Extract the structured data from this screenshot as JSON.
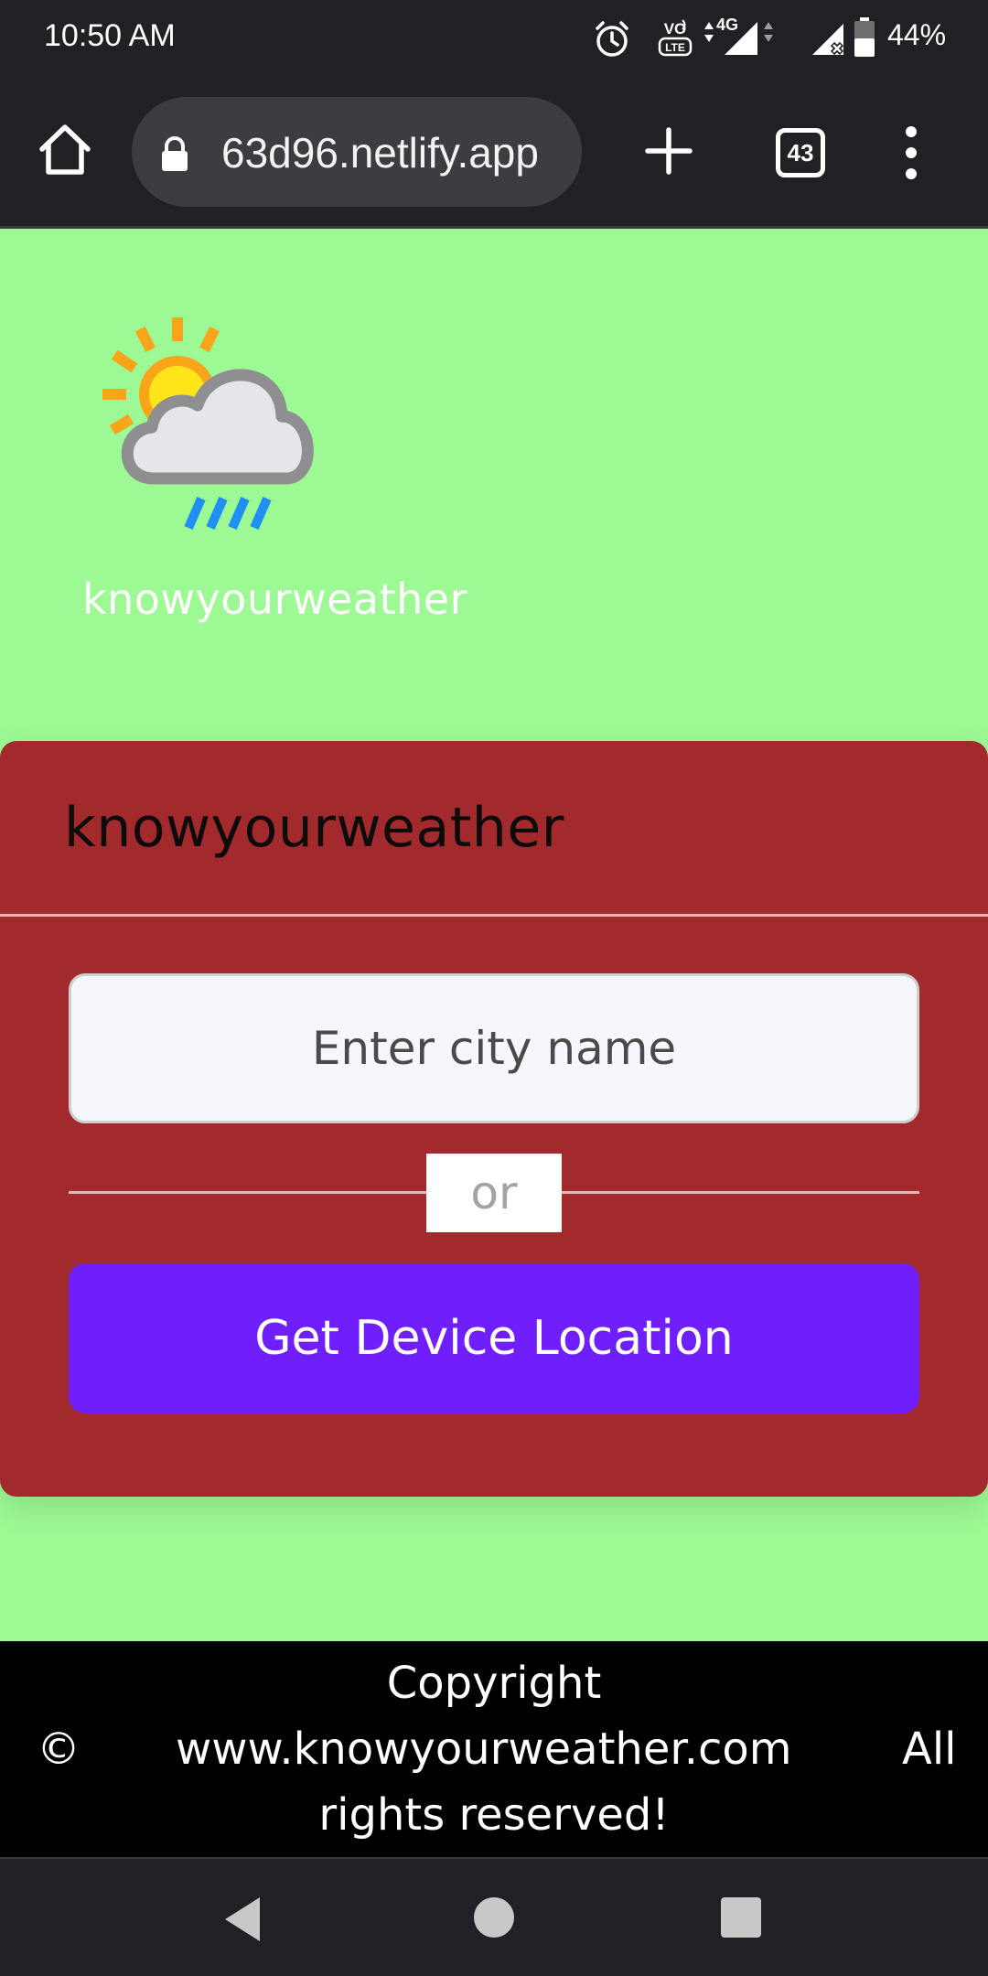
{
  "status_bar": {
    "time": "10:50 AM",
    "network": "4G",
    "volte": "VO LTE",
    "battery_percent": "44%",
    "icons": [
      "alarm-icon",
      "volte-icon",
      "signal-4g-icon",
      "signal-no-sim-icon",
      "battery-icon"
    ]
  },
  "browser": {
    "url": "63d96.netlify.app",
    "tab_count": "43",
    "icons": [
      "home-icon",
      "lock-icon",
      "plus-icon",
      "tabs-icon",
      "more-vert-icon"
    ]
  },
  "logo": {
    "text": "knowyourweather",
    "icon": "sun-cloud-rain-icon"
  },
  "card": {
    "title": "knowyourweather",
    "city_input_placeholder": "Enter city name",
    "or_label": "or",
    "location_button": "Get Device Location"
  },
  "footer": {
    "line1": "Copyright",
    "symbol": "©",
    "domain": "www.knowyourweather.com",
    "all": "All",
    "line3": "rights reserved!"
  },
  "nav": {
    "icons": [
      "back-icon",
      "home-circle-icon",
      "recents-icon"
    ]
  },
  "colors": {
    "page_background": "#9cf994",
    "card_background": "#a2292c",
    "button_background": "#6f1ffb",
    "footer_background": "#000000",
    "chrome_background": "#202124"
  }
}
